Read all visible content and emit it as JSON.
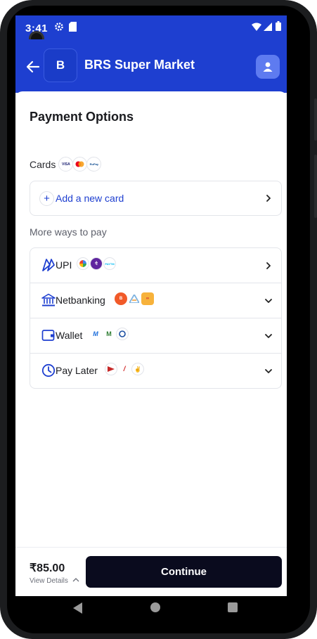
{
  "status_bar": {
    "time": "3:41"
  },
  "header": {
    "logo_letter": "B",
    "merchant_name": "BRS Super Market"
  },
  "page": {
    "title": "Payment Options"
  },
  "cards": {
    "label": "Cards",
    "brands": [
      "VISA",
      "Mastercard",
      "RuPay"
    ],
    "add_new_label": "Add a new card"
  },
  "more_ways": {
    "label": "More ways to pay",
    "options": [
      {
        "label": "UPI",
        "icon": "upi-icon",
        "logos": [
          "Google Pay",
          "PhonePe",
          "Paytm"
        ]
      },
      {
        "label": "Netbanking",
        "icon": "bank-icon",
        "logos": [
          "Bank of Baroda",
          "Axis Bank",
          "Kotak"
        ]
      },
      {
        "label": "Wallet",
        "icon": "wallet-icon",
        "logos": [
          "MobiKwik",
          "Amazon Pay",
          "Ola Money"
        ]
      },
      {
        "label": "Pay Later",
        "icon": "clock-icon",
        "logos": [
          "Simpl",
          "Lazypay",
          "ZestMoney"
        ]
      }
    ]
  },
  "footer": {
    "amount": "₹85.00",
    "view_details": "View Details",
    "continue_label": "Continue"
  },
  "colors": {
    "brand": "#1e3fd0",
    "button": "#0a0b1e"
  }
}
